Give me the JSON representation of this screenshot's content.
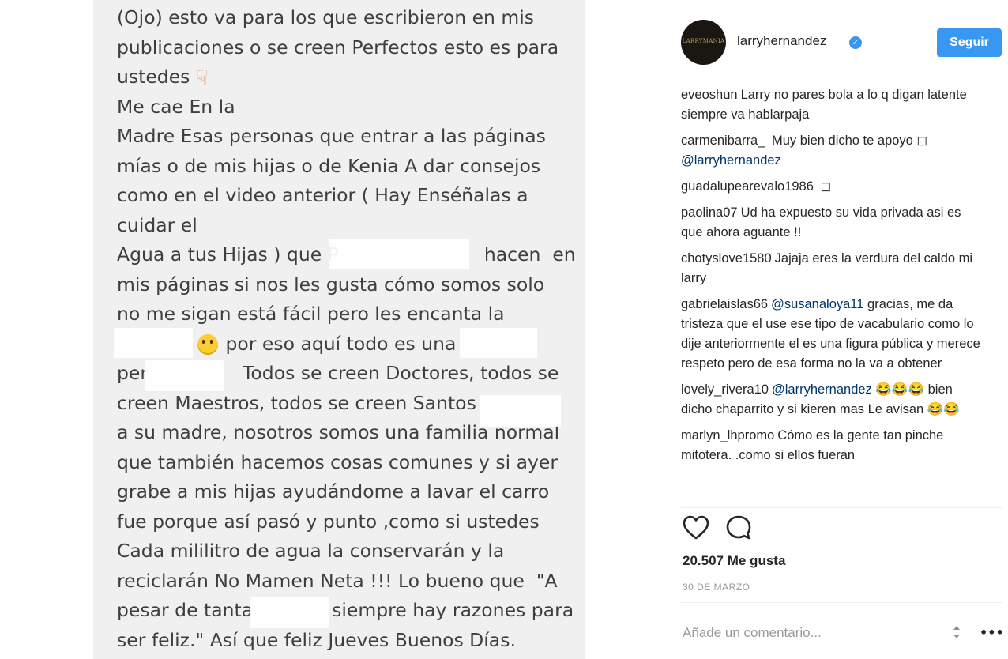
{
  "post": {
    "text_lines": [
      "(Ojo) esto va para los que escribieron en mis",
      "publicaciones o se creen Perfectos esto es para",
      "ustedes",
      "Me cae En la",
      "Madre Esas personas que entrar a las páginas",
      "mías o de mis hijas o de Kenia A dar consejos",
      "como en el video anterior ( Hay Enséñalas a",
      "cuidar el",
      "Agua a tus Hijas ) que P",
      "hacen  en",
      "mis páginas si nos les gusta cómo somos solo",
      "no me sigan está fácil pero les encanta la",
      "por eso aquí todo es una",
      "per",
      "Todos se creen Doctores, todos se",
      "creen Maestros, todos se creen Santos",
      "a su madre, nosotros somos una familia normal",
      "que también hacemos cosas comunes y si ayer",
      "grabe a mis hijas ayudándome a lavar el carro",
      "fue porque así pasó y punto ,como si ustedes",
      "Cada mililitro de agua la conservarán y la",
      "reciclarán No Mamen Neta !!! Lo bueno que  \"A",
      "pesar de tanta",
      "siempre hay razones para",
      "ser feliz.\" Así que feliz Jueves Buenos Días."
    ]
  },
  "header": {
    "username": "larryhernandez",
    "avatar_text": "LARRYMANIA",
    "follow_label": "Seguir"
  },
  "comments": [
    {
      "user": "eveoshun",
      "text": "Larry no pares bola a lo q digan latente siempre va hablarpaja"
    },
    {
      "user": "carmenibarra_",
      "text": "Muy bien dicho te apoyo ◻︎",
      "mention": "@larryhernandez"
    },
    {
      "user": "guadalupearevalo1986",
      "text": "◻︎"
    },
    {
      "user": "paolina07",
      "text": "Ud ha expuesto su vida privada asi es que ahora aguante !!"
    },
    {
      "user": "chotyslove1580",
      "text": "Jajaja eres la verdura del caldo mi larry"
    },
    {
      "user": "gabrielaislas66",
      "mention": "@susanaloya11",
      "text": "gracias, me da tristeza que el use ese tipo de vacabulario como lo dije anteriormente el es una figura pública y merece respeto pero de esa forma no la va a obtener"
    },
    {
      "user": "lovely_rivera10",
      "mention": "@larryhernandez",
      "text": "😂😂😂 bien dicho chaparrito y si kieren mas Le avisan 😂😂"
    },
    {
      "user": "marlyn_lhpromo",
      "text": "Cómo es la gente tan pinche mitotera. .como si ellos fueran"
    }
  ],
  "actions": {
    "likes": "20.507 Me gusta",
    "date": "30 DE MARZO",
    "comment_placeholder": "Añade un comentario...",
    "more_label": "•••"
  },
  "icons": {
    "like": "heart-icon",
    "comment": "comment-bubble-icon",
    "verified": "verified-badge-icon",
    "scroll": "scroll-arrows-icon"
  },
  "colors": {
    "accent": "#3897f0",
    "text": "#262626",
    "muted": "#999999"
  }
}
